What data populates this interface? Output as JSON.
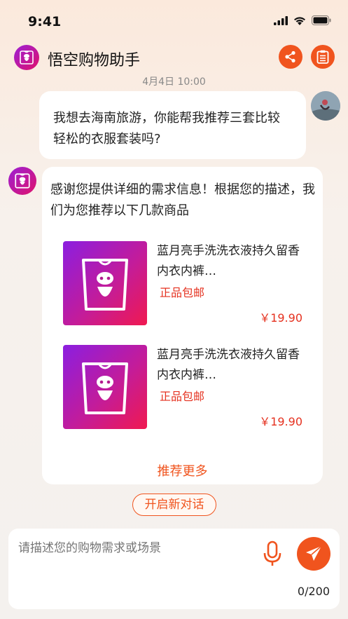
{
  "status_bar": {
    "time": "9:41"
  },
  "header": {
    "title": "悟空购物助手"
  },
  "chat": {
    "timestamp": "4月4日 10:00",
    "user_message": "我想去海南旅游，你能帮我推荐三套比较轻松的衣服套装吗?",
    "bot_intro": "感谢您提供详细的需求信息！根据您的描述，我们为您推荐以下几款商品",
    "products": [
      {
        "title": "蓝月亮手洗洗衣液持久留香内衣内裤…",
        "tag": "正品包邮",
        "price": "￥19.90"
      },
      {
        "title": "蓝月亮手洗洗衣液持久留香内衣内裤…",
        "tag": "正品包邮",
        "price": "￥19.90"
      }
    ],
    "recommend_more": "推荐更多",
    "new_chat": "开启新对话"
  },
  "composer": {
    "placeholder": "请描述您的购物需求或场景",
    "char_count": "0/200"
  },
  "colors": {
    "accent": "#f0541e",
    "price": "#e5311f",
    "brand_gradient_start": "#9b1fd6",
    "brand_gradient_end": "#e0136b"
  },
  "icons": [
    "signal-icon",
    "wifi-icon",
    "battery-icon",
    "robot-logo-icon",
    "share-icon",
    "clipboard-icon",
    "microphone-icon",
    "send-icon"
  ]
}
